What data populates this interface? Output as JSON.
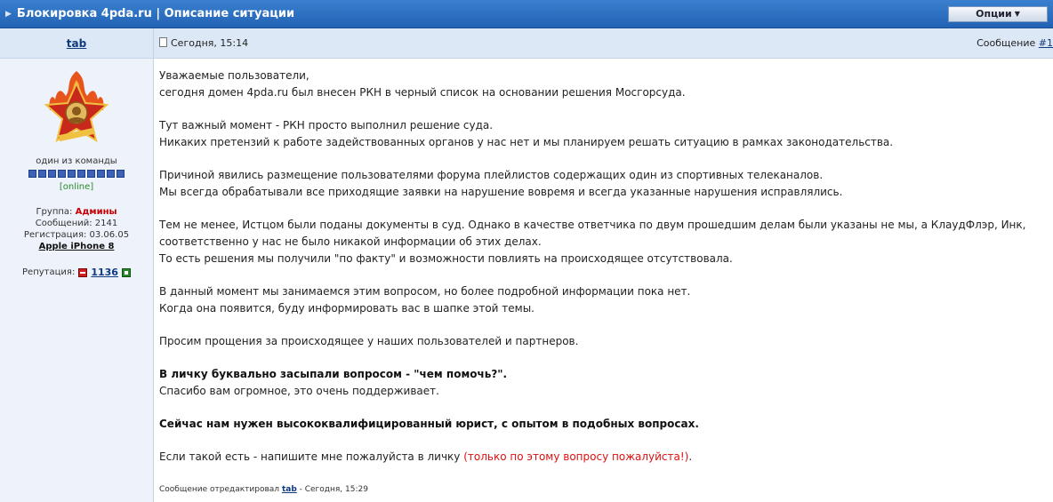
{
  "topic": {
    "title": "Блокировка 4pda.ru | Описание ситуации",
    "options_label": "Опции"
  },
  "post": {
    "author": "tab",
    "date": "Сегодня, 15:14",
    "msg_label": "Сообщение",
    "msg_num": "#1"
  },
  "author_info": {
    "rank": "один из команды",
    "status": "[online]",
    "group_label": "Группа:",
    "group_value": "Админы",
    "posts": "Сообщений: 2141",
    "reg": "Регистрация: 03.06.05",
    "device": "Apple iPhone 8",
    "rep_label": "Репутация:",
    "rep_value": "1136"
  },
  "content": {
    "p1a": "Уважаемые пользователи,",
    "p1b": "сегодня домен 4pda.ru был внесен РКН в черный список на основании решения Мосгорсуда.",
    "p2a": "Тут важный момент - РКН просто выполнил решение суда.",
    "p2b": "Никаких претензий к работе задействованных органов у нас нет и мы планируем решать ситуацию в рамках законодательства.",
    "p3a": "Причиной явились размещение пользователями форума плейлистов содержащих один из спортивных телеканалов.",
    "p3b": "Мы всегда обрабатывали все приходящие заявки на нарушение вовремя и всегда указанные нарушения исправлялись.",
    "p4a": "Тем не менее, Истцом были поданы документы в суд. Однако в качестве ответчика по двум прошедшим делам были указаны не мы, а КлаудФлэр, Инк,",
    "p4b": "соответственно у нас не было никакой информации об этих делах.",
    "p4c": "То есть решения мы получили \"по факту\" и возможности повлиять на происходящее отсутствовала.",
    "p5a": "В данный момент мы занимаемся этим вопросом, но более подробной информации пока нет.",
    "p5b": "Когда она появится, буду информировать вас в шапке этой темы.",
    "p6": "Просим прощения за происходящее у наших пользователей и партнеров.",
    "p7a": "В личку буквально засыпали вопросом - \"чем помочь?\".",
    "p7b": "Спасибо вам огромное, это очень поддерживает.",
    "p8": "Сейчас нам нужен высококвалифицированный юрист, с опытом в подобных вопросах.",
    "p9_main": "Если такой есть - напишите мне пожалуйста в личку ",
    "p9_red": "(только по этому вопросу пожалуйста!)",
    "p9_end": ".",
    "edited_prefix": "Сообщение отредактировал",
    "edited_user": "tab",
    "edited_suffix": " - Сегодня, 15:29"
  },
  "icons": {
    "avatar": "pioneer-star-icon",
    "title_arrow": "triangle-right-icon",
    "options_caret": "caret-down-icon",
    "post_date": "document-icon",
    "rep_minus": "minus-icon",
    "rep_plus": "plus-icon"
  }
}
